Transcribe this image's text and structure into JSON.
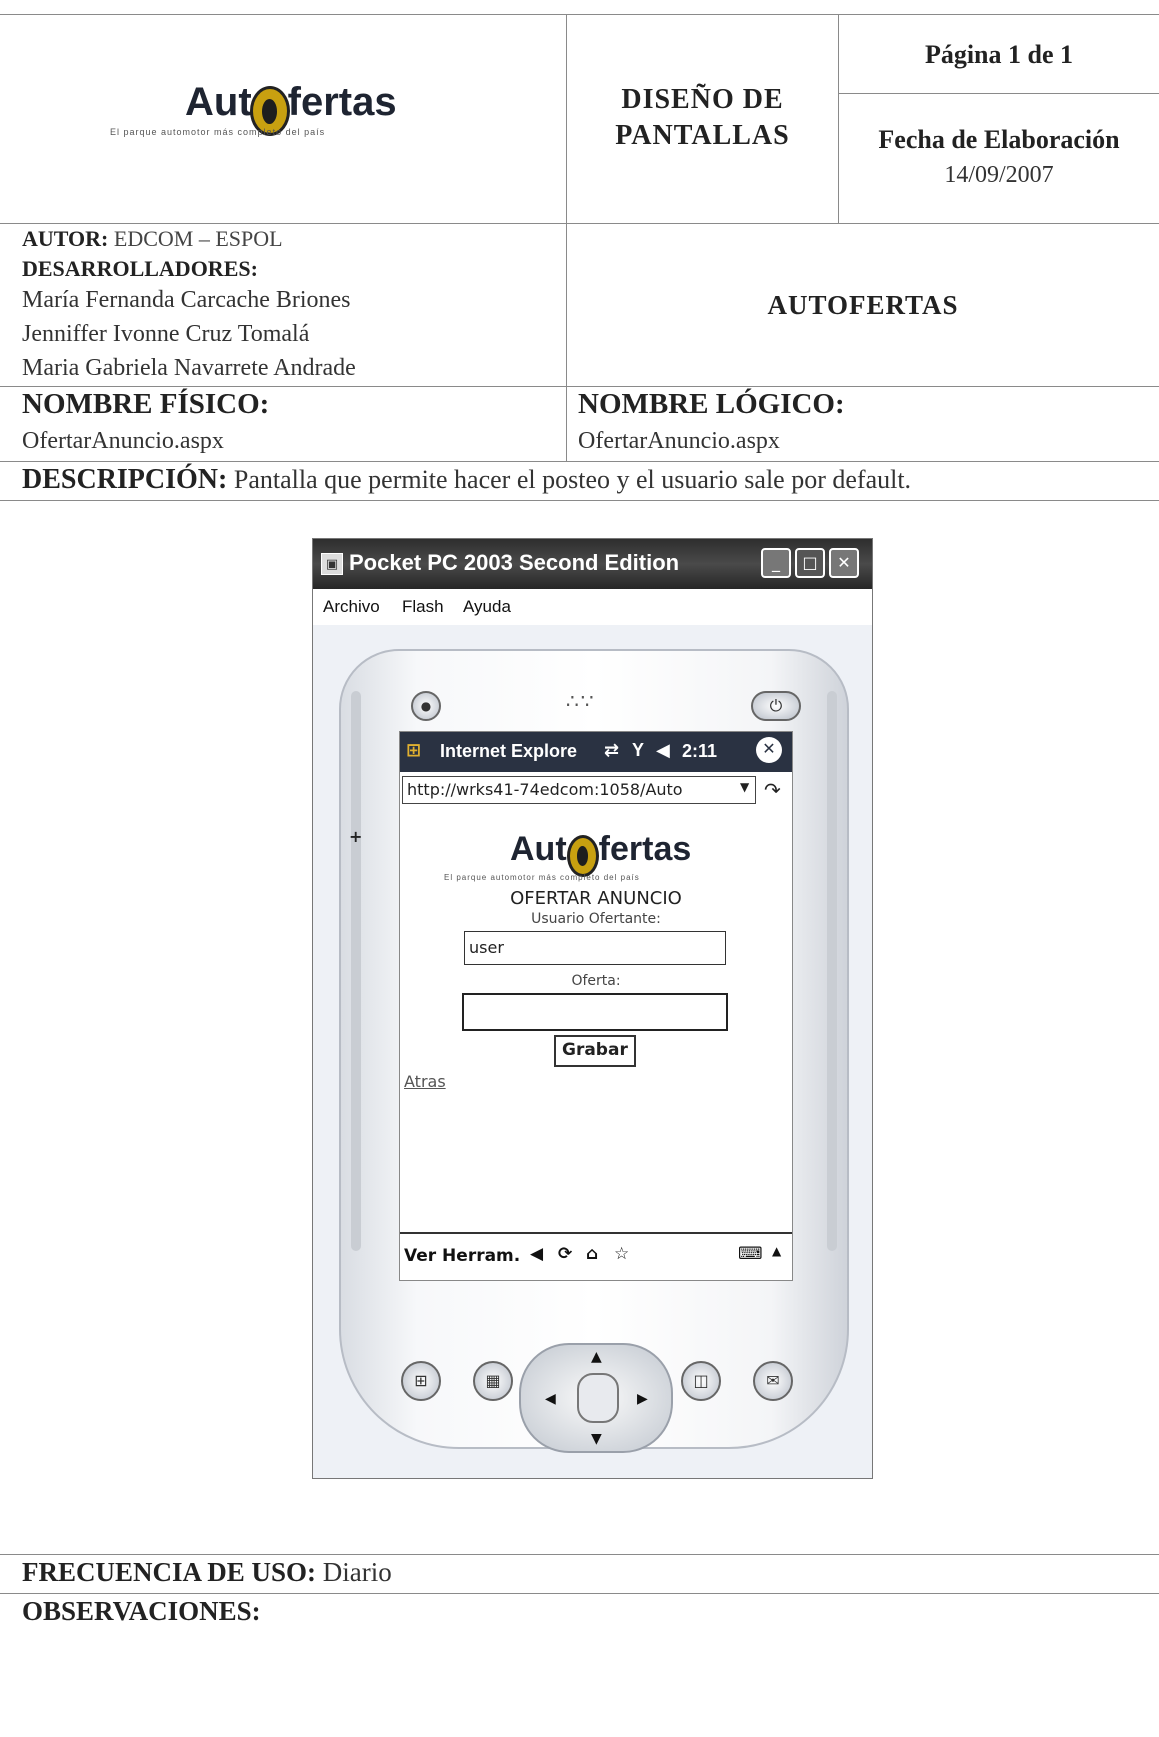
{
  "header": {
    "logo_prefix": "Aut",
    "logo_suffix": "fertas",
    "tagline": "El parque automotor más completo del país",
    "doc_title_line1": "DISEÑO DE",
    "doc_title_line2": "PANTALLAS",
    "page": "Página 1 de 1",
    "date_label": "Fecha de Elaboración",
    "date_value": "14/09/2007"
  },
  "authors": {
    "autor_label": "AUTOR:",
    "autor_value": "EDCOM – ESPOL",
    "dev_label": "DESARROLLADORES:",
    "developers": [
      "María Fernanda Carcache Briones",
      "Jenniffer Ivonne Cruz Tomalá",
      "Maria Gabriela Navarrete Andrade"
    ],
    "project": "AUTOFERTAS"
  },
  "names": {
    "fisico_label": "NOMBRE FÍSICO:",
    "fisico_value": "OfertarAnuncio.aspx",
    "logico_label": "NOMBRE LÓGICO:",
    "logico_value": "OfertarAnuncio.aspx"
  },
  "description": {
    "label": "DESCRIPCIÓN:",
    "text": "Pantalla que permite hacer el posteo y el usuario sale por default."
  },
  "emulator": {
    "window_title": "Pocket PC 2003 Second Edition",
    "menu": [
      "Archivo",
      "Flash",
      "Ayuda"
    ],
    "ie_title": "Internet Explore",
    "ie_time": "2:11",
    "address": "http://wrks41-74edcom:1058/Auto",
    "page_heading": "OFERTAR ANUNCIO",
    "user_label": "Usuario Ofertante:",
    "user_value": "user",
    "offer_label": "Oferta:",
    "offer_value": "",
    "save_button": "Grabar",
    "back_link": "Atras",
    "bottom_bar": "Ver Herram."
  },
  "footer": {
    "freq_label": "FRECUENCIA DE USO:",
    "freq_value": "Diario",
    "obs_label": "OBSERVACIONES:"
  }
}
